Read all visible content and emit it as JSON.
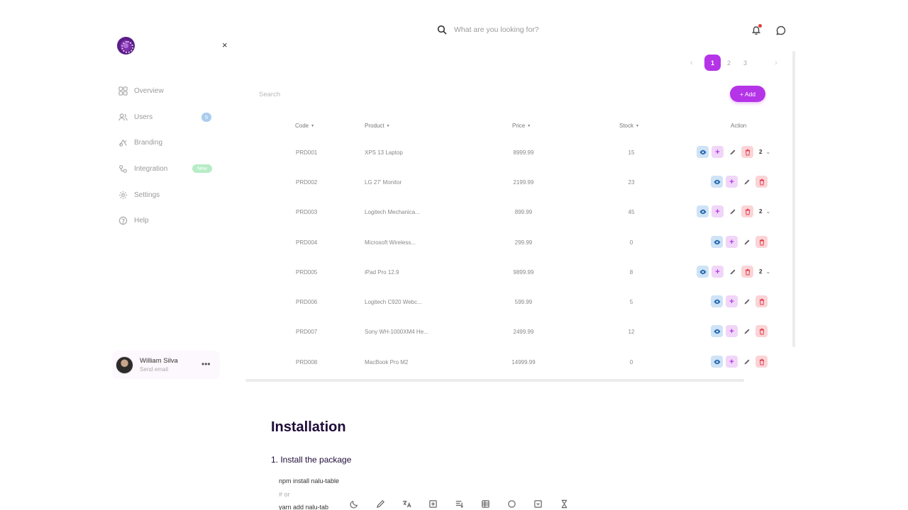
{
  "sidebar": {
    "close_label": "×",
    "items": [
      {
        "label": "Overview",
        "icon": "grid-icon"
      },
      {
        "label": "Users",
        "icon": "users-icon",
        "badge": "5"
      },
      {
        "label": "Branding",
        "icon": "palette-icon"
      },
      {
        "label": "Integration",
        "icon": "plug-icon",
        "badge": "New"
      },
      {
        "label": "Settings",
        "icon": "gear-icon"
      },
      {
        "label": "Help",
        "icon": "help-icon"
      }
    ],
    "user": {
      "name": "William Silva",
      "subtitle": "Send email",
      "more": "•••"
    }
  },
  "header": {
    "search_placeholder": "What are you looking for?"
  },
  "pagination": {
    "prev": "‹",
    "pages": [
      "1",
      "2",
      "3"
    ],
    "current": "1",
    "next": "›"
  },
  "table": {
    "search_placeholder": "Search",
    "add_label": "+ Add",
    "columns": [
      "Code",
      "Product",
      "Price",
      "Stock",
      "Action"
    ],
    "rows": [
      {
        "code": "PRD001",
        "product": "XPS 13 Laptop",
        "price": "8999.99",
        "stock": "15",
        "count": "2"
      },
      {
        "code": "PRD002",
        "product": "LG 27' Monitor",
        "price": "2199.99",
        "stock": "23",
        "count": ""
      },
      {
        "code": "PRD003",
        "product": "Logitech Mechanica...",
        "price": "899.99",
        "stock": "45",
        "count": "2"
      },
      {
        "code": "PRD004",
        "product": "Microsoft Wireless...",
        "price": "299.99",
        "stock": "0",
        "count": ""
      },
      {
        "code": "PRD005",
        "product": "iPad Pro 12.9",
        "price": "9899.99",
        "stock": "8",
        "count": "2"
      },
      {
        "code": "PRD006",
        "product": "Logitech C920 Webc...",
        "price": "599.99",
        "stock": "5",
        "count": ""
      },
      {
        "code": "PRD007",
        "product": "Sony WH-1000XM4 He...",
        "price": "2499.99",
        "stock": "12",
        "count": ""
      },
      {
        "code": "PRD008",
        "product": "MacBook Pro M2",
        "price": "14999.99",
        "stock": "0",
        "count": ""
      }
    ]
  },
  "docs": {
    "title": "Installation",
    "step1": "1. Install the package",
    "code": [
      "npm install nalu-table",
      "# or",
      "yarn add nalu-tab"
    ]
  },
  "colors": {
    "accent": "#b534e8",
    "view": "#cfe3f6",
    "plus": "#f0d6f8",
    "delete": "#fbd4d7"
  }
}
